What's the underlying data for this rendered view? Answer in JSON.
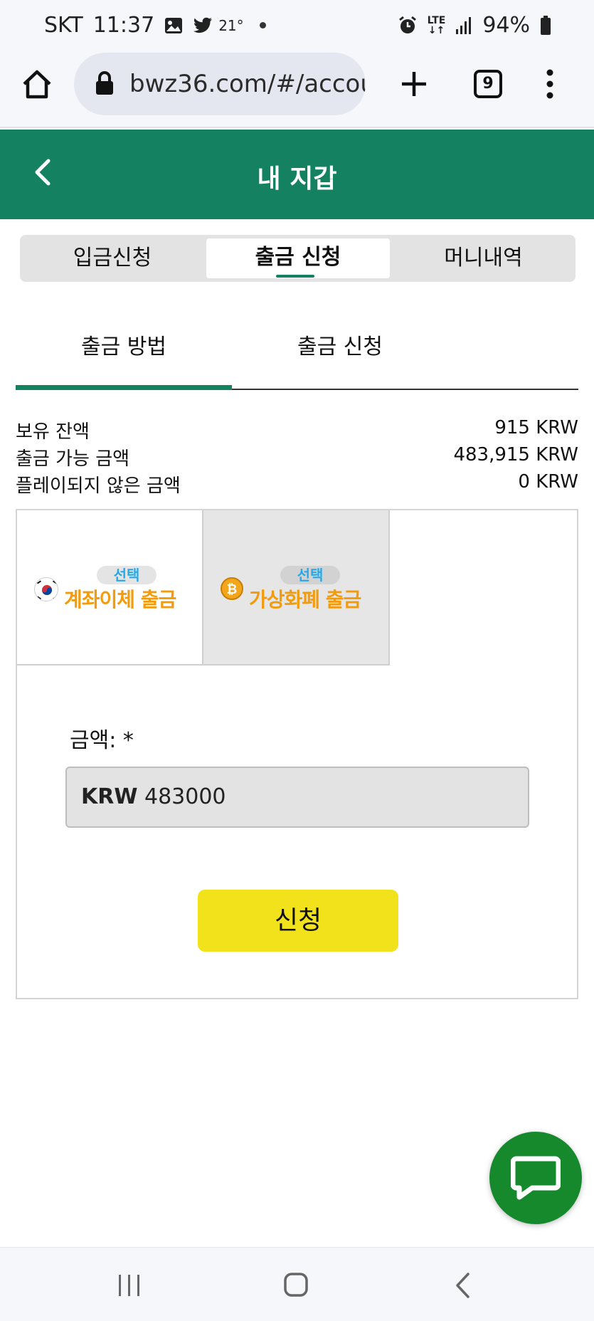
{
  "status_bar": {
    "carrier": "SKT",
    "time": "11:37",
    "temperature": "21°",
    "network": "LTE",
    "battery": "94%"
  },
  "browser": {
    "url": "bwz36.com/#/accou",
    "tab_count": "9"
  },
  "header": {
    "title": "내 지갑"
  },
  "top_tabs": [
    {
      "label": "입금신청",
      "active": false
    },
    {
      "label": "출금 신청",
      "active": true
    },
    {
      "label": "머니내역",
      "active": false
    }
  ],
  "sub_tabs": [
    {
      "label": "출금 방법",
      "active": true
    },
    {
      "label": "출금 신청",
      "active": false
    }
  ],
  "balances": [
    {
      "label": "보유 잔액",
      "value": "915 KRW"
    },
    {
      "label": "출금 가능 금액",
      "value": "483,915 KRW"
    },
    {
      "label": "플레이되지 않은 금액",
      "value": "0 KRW"
    }
  ],
  "methods": [
    {
      "badge": "선택",
      "label": "계좌이체 출금",
      "icon": "korea-flag-icon",
      "selected": false
    },
    {
      "badge": "선택",
      "label": "가상화폐 출금",
      "icon": "bitcoin-icon",
      "selected": true
    }
  ],
  "form": {
    "amount_label": "금액: *",
    "currency": "KRW",
    "amount_value": "483000",
    "submit_label": "신청"
  },
  "colors": {
    "brand_green": "#148261",
    "button_yellow": "#f1e21b",
    "method_orange": "#f29b0c",
    "badge_blue": "#29a8e8",
    "chat_green": "#16892d"
  }
}
